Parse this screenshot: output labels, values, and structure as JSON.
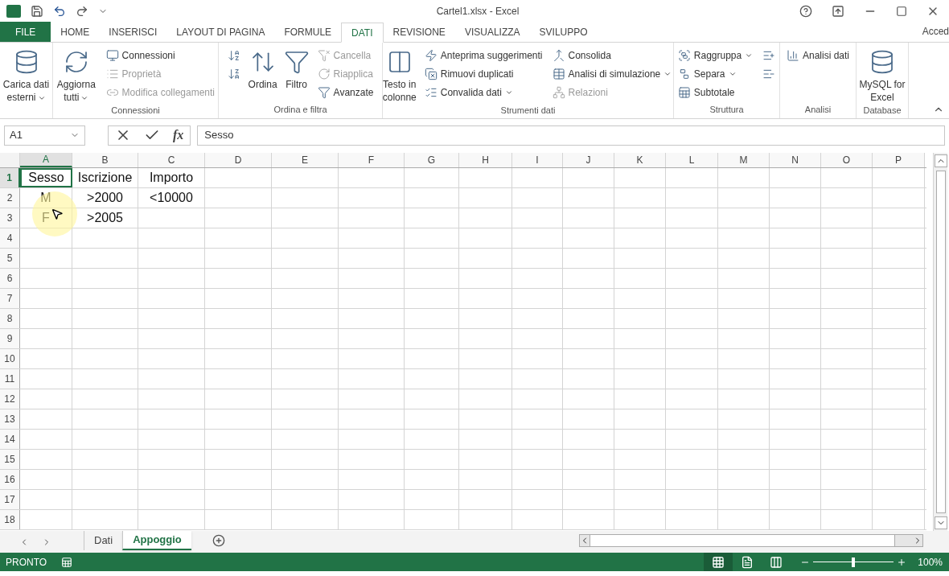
{
  "window": {
    "title": "Cartel1.xlsx - Excel",
    "account": "Acced"
  },
  "tabs": [
    {
      "label": "FILE",
      "kind": "file",
      "selected": false
    },
    {
      "label": "HOME",
      "kind": "tab",
      "selected": false
    },
    {
      "label": "INSERISCI",
      "kind": "tab",
      "selected": false
    },
    {
      "label": "LAYOUT DI PAGINA",
      "kind": "tab",
      "selected": false
    },
    {
      "label": "FORMULE",
      "kind": "tab",
      "selected": false
    },
    {
      "label": "DATI",
      "kind": "tab",
      "selected": true
    },
    {
      "label": "REVISIONE",
      "kind": "tab",
      "selected": false
    },
    {
      "label": "VISUALIZZA",
      "kind": "tab",
      "selected": false
    },
    {
      "label": "SVILUPPO",
      "kind": "tab",
      "selected": false
    }
  ],
  "ribbon": [
    {
      "columns": [
        [
          {
            "kind": "large",
            "label": "Carica dati esterni",
            "dropdown": true,
            "disabled": false
          }
        ]
      ]
    },
    {
      "label": "Connessioni",
      "columns": [
        [
          {
            "kind": "large",
            "label": "Aggiorna tutti",
            "dropdown": true,
            "disabled": false
          }
        ],
        [
          {
            "kind": "small",
            "label": "Connessioni",
            "dropdown": false,
            "disabled": false
          },
          {
            "kind": "small",
            "label": "Proprietà",
            "dropdown": false,
            "disabled": true
          },
          {
            "kind": "small",
            "label": "Modifica collegamenti",
            "dropdown": false,
            "disabled": true
          }
        ]
      ]
    },
    {
      "label": "Ordina e filtra",
      "columns": [
        [
          {
            "kind": "icon",
            "dropdown": false,
            "disabled": false
          },
          {
            "kind": "icon",
            "dropdown": false,
            "disabled": false
          }
        ],
        [
          {
            "kind": "large",
            "label": "Ordina",
            "dropdown": false,
            "disabled": false
          }
        ],
        [
          {
            "kind": "large",
            "label": "Filtro",
            "dropdown": false,
            "disabled": false
          }
        ],
        [
          {
            "kind": "small",
            "label": "Cancella",
            "dropdown": false,
            "disabled": true
          },
          {
            "kind": "small",
            "label": "Riapplica",
            "dropdown": false,
            "disabled": true
          },
          {
            "kind": "small",
            "label": "Avanzate",
            "dropdown": false,
            "disabled": false
          }
        ]
      ]
    },
    {
      "label": "Strumenti dati",
      "columns": [
        [
          {
            "kind": "large",
            "label": "Testo in colonne",
            "dropdown": false,
            "disabled": false
          }
        ],
        [
          {
            "kind": "small",
            "label": "Anteprima suggerimenti",
            "dropdown": false,
            "disabled": false
          },
          {
            "kind": "small",
            "label": "Rimuovi duplicati",
            "dropdown": false,
            "disabled": false
          },
          {
            "kind": "small",
            "label": "Convalida dati",
            "dropdown": true,
            "disabled": false
          }
        ],
        [
          {
            "kind": "small",
            "label": "Consolida",
            "dropdown": false,
            "disabled": false
          },
          {
            "kind": "small",
            "label": "Analisi di simulazione",
            "dropdown": true,
            "disabled": false
          },
          {
            "kind": "small",
            "label": "Relazioni",
            "dropdown": false,
            "disabled": true
          }
        ]
      ]
    },
    {
      "label": "Struttura",
      "columns": [
        [
          {
            "kind": "small",
            "label": "Raggruppa",
            "dropdown": true,
            "disabled": false
          },
          {
            "kind": "small",
            "label": "Separa",
            "dropdown": true,
            "disabled": false
          },
          {
            "kind": "small",
            "label": "Subtotale",
            "dropdown": false,
            "disabled": false
          }
        ],
        [
          {
            "kind": "icon",
            "dropdown": false,
            "disabled": false
          },
          {
            "kind": "icon",
            "dropdown": false,
            "disabled": false
          }
        ]
      ]
    },
    {
      "label": "Analisi",
      "columns": [
        [
          {
            "kind": "small",
            "label": "Analisi dati",
            "dropdown": false,
            "disabled": false
          }
        ]
      ]
    },
    {
      "label": "Database",
      "columns": [
        [
          {
            "kind": "large",
            "label": "MySQL for Excel",
            "dropdown": false,
            "disabled": false
          }
        ]
      ]
    }
  ],
  "formula_bar": {
    "name_box": "A1",
    "function_label": "fx",
    "value": "Sesso"
  },
  "columns": [
    {
      "label": "A",
      "selected": true
    },
    {
      "label": "B",
      "selected": false
    },
    {
      "label": "C",
      "selected": false
    },
    {
      "label": "D",
      "selected": false
    },
    {
      "label": "E",
      "selected": false
    },
    {
      "label": "F",
      "selected": false
    },
    {
      "label": "G",
      "selected": false
    },
    {
      "label": "H",
      "selected": false
    },
    {
      "label": "I",
      "selected": false
    },
    {
      "label": "J",
      "selected": false
    },
    {
      "label": "K",
      "selected": false
    },
    {
      "label": "L",
      "selected": false
    },
    {
      "label": "M",
      "selected": false
    },
    {
      "label": "N",
      "selected": false
    },
    {
      "label": "O",
      "selected": false
    },
    {
      "label": "P",
      "selected": false
    }
  ],
  "rows": [
    {
      "header": "1",
      "selected": true,
      "cells": [
        "Sesso",
        "Iscrizione",
        "Importo"
      ]
    },
    {
      "header": "2",
      "selected": false,
      "cells": [
        "M",
        ">2000",
        "<10000"
      ]
    },
    {
      "header": "3",
      "selected": false,
      "cells": [
        "F",
        ">2005"
      ]
    },
    {
      "header": "4",
      "selected": false
    },
    {
      "header": "5",
      "selected": false
    },
    {
      "header": "6",
      "selected": false
    },
    {
      "header": "7",
      "selected": false
    },
    {
      "header": "8",
      "selected": false
    },
    {
      "header": "9",
      "selected": false
    },
    {
      "header": "10",
      "selected": false
    },
    {
      "header": "11",
      "selected": false
    },
    {
      "header": "12",
      "selected": false
    },
    {
      "header": "13",
      "selected": false
    },
    {
      "header": "14",
      "selected": false
    },
    {
      "header": "15",
      "selected": false
    },
    {
      "header": "16",
      "selected": false
    },
    {
      "header": "17",
      "selected": false
    },
    {
      "header": "18",
      "selected": false
    }
  ],
  "sheets": [
    {
      "label": "Dati",
      "selected": false
    },
    {
      "label": "Appoggio",
      "selected": true
    }
  ],
  "status_bar": {
    "text": "PRONTO",
    "views": [
      {
        "selected": true
      },
      {
        "selected": false
      },
      {
        "selected": false
      }
    ],
    "zoom": {
      "level": 0.5,
      "reading": "100%"
    }
  }
}
